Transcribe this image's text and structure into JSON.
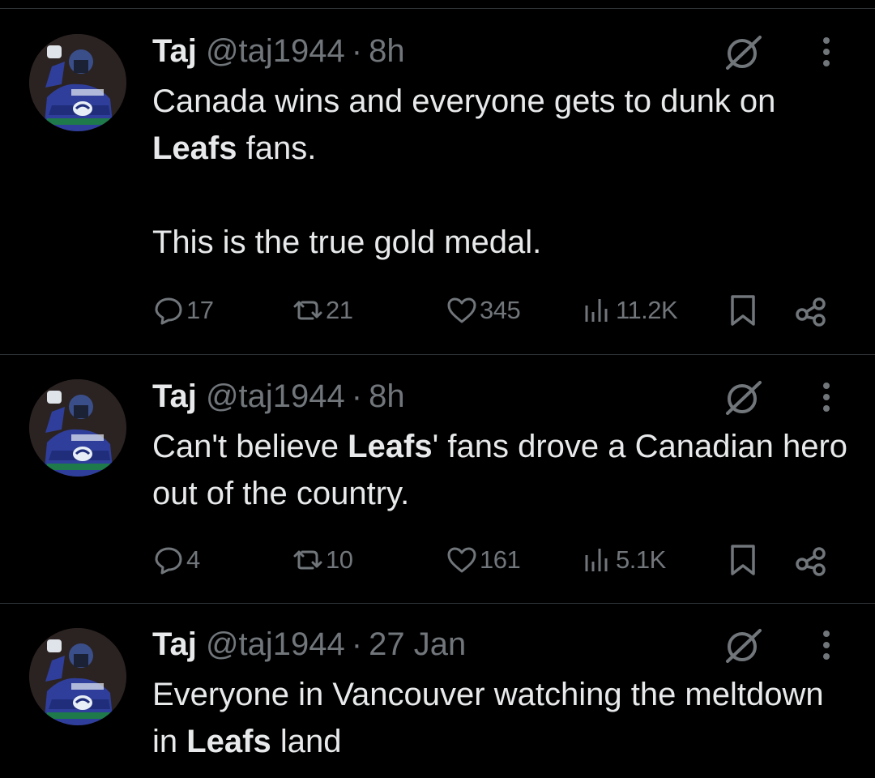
{
  "colors": {
    "background": "#000000",
    "text_primary": "#e7e9ea",
    "text_secondary": "#71767b",
    "divider": "#2f3336"
  },
  "icons": {
    "reply": "speech-bubble-icon",
    "retweet": "retweet-arrows-icon",
    "like": "heart-icon",
    "views": "bar-chart-icon",
    "bookmark": "bookmark-icon",
    "share": "share-nodes-icon",
    "grok": "grok-slash-circle-icon",
    "more": "vertical-ellipsis-icon"
  },
  "tweets": [
    {
      "name": "Taj",
      "handle": "@taj1944",
      "separator": "·",
      "time": "8h",
      "text": {
        "line1_pre": "Canada wins and everyone gets to dunk on ",
        "line1_bold": "Leafs",
        "line1_post": " fans.",
        "line2": "This is the true gold medal."
      },
      "stats": {
        "replies": "17",
        "retweets": "21",
        "likes": "345",
        "views": "11.2K"
      }
    },
    {
      "name": "Taj",
      "handle": "@taj1944",
      "separator": "·",
      "time": "8h",
      "text": {
        "line1_pre": "Can't believe ",
        "line1_bold": "Leafs",
        "line1_post": "' fans drove a Canadian hero out of the country."
      },
      "stats": {
        "replies": "4",
        "retweets": "10",
        "likes": "161",
        "views": "5.1K"
      }
    },
    {
      "name": "Taj",
      "handle": "@taj1944",
      "separator": "·",
      "time": "27 Jan",
      "text": {
        "line1_pre": "Everyone in Vancouver watching the meltdown in ",
        "line1_bold": "Leafs",
        "line1_post": " land"
      }
    }
  ]
}
